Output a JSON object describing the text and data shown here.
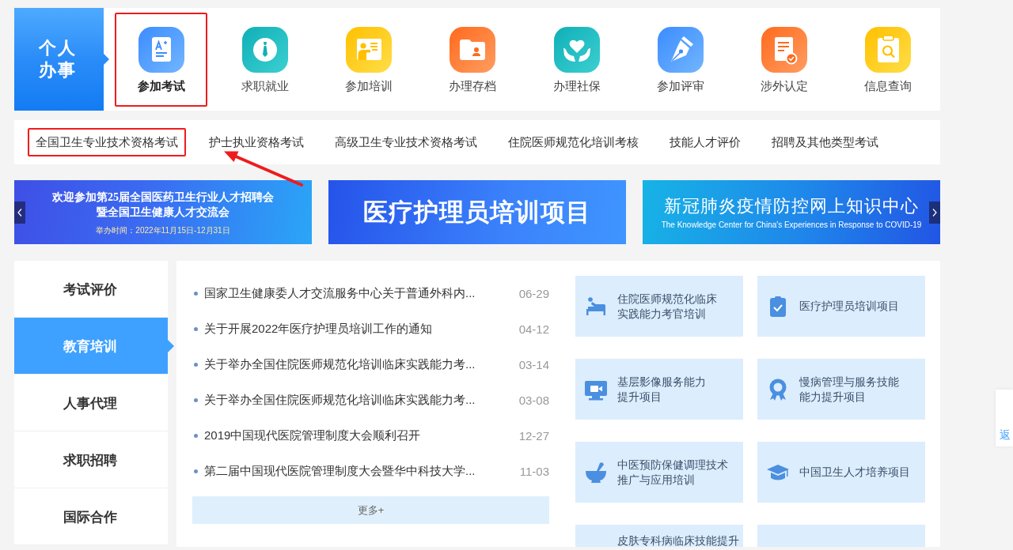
{
  "service_panel": {
    "title": "个人办事",
    "items": [
      {
        "label": "参加考试",
        "selected": true,
        "highlighted": true
      },
      {
        "label": "求职就业",
        "selected": false,
        "highlighted": false
      },
      {
        "label": "参加培训",
        "selected": false,
        "highlighted": false
      },
      {
        "label": "办理存档",
        "selected": false,
        "highlighted": false
      },
      {
        "label": "办理社保",
        "selected": false,
        "highlighted": false
      },
      {
        "label": "参加评审",
        "selected": false,
        "highlighted": false
      },
      {
        "label": "涉外认定",
        "selected": false,
        "highlighted": false
      },
      {
        "label": "信息查询",
        "selected": false,
        "highlighted": false
      }
    ]
  },
  "exam_categories": [
    {
      "label": "全国卫生专业技术资格考试",
      "highlighted": true
    },
    {
      "label": "护士执业资格考试",
      "highlighted": false
    },
    {
      "label": "高级卫生专业技术资格考试",
      "highlighted": false
    },
    {
      "label": "住院医师规范化培训考核",
      "highlighted": false
    },
    {
      "label": "技能人才评价",
      "highlighted": false
    },
    {
      "label": "招聘及其他类型考试",
      "highlighted": false
    }
  ],
  "banners": [
    {
      "kind": "event",
      "title": "欢迎参加第25届全国医药卫生行业人才招聘会",
      "subtitle": "暨全国卫生健康人才交流会",
      "note": "举办时间：2022年11月15日-12月31日"
    },
    {
      "kind": "headline",
      "title": "医疗护理员培训项目"
    },
    {
      "kind": "bilingual",
      "title": "新冠肺炎疫情防控网上知识中心",
      "subtitle": "The Knowledge Center for China's Experiences in Response to COVID-19"
    }
  ],
  "sidebar": {
    "tabs": [
      {
        "label": "考试评价",
        "selected": false
      },
      {
        "label": "教育培训",
        "selected": true
      },
      {
        "label": "人事代理",
        "selected": false
      },
      {
        "label": "求职招聘",
        "selected": false
      },
      {
        "label": "国际合作",
        "selected": false
      }
    ]
  },
  "news": {
    "items": [
      {
        "title": "国家卫生健康委人才交流服务中心关于普通外科内...",
        "date": "06-29"
      },
      {
        "title": "关于开展2022年医疗护理员培训工作的通知",
        "date": "04-12"
      },
      {
        "title": "关于举办全国住院医师规范化培训临床实践能力考...",
        "date": "03-14"
      },
      {
        "title": "关于举办全国住院医师规范化培训临床实践能力考...",
        "date": "03-08"
      },
      {
        "title": "2019中国现代医院管理制度大会顺利召开",
        "date": "12-27"
      },
      {
        "title": "第二届中国现代医院管理制度大会暨华中科技大学...",
        "date": "11-03"
      }
    ],
    "more_button": "更多+"
  },
  "projects": [
    {
      "title_lines": [
        "住院医师规范化临床",
        "实践能力考官培训"
      ]
    },
    {
      "title_lines": [
        "医疗护理员培训项目"
      ]
    },
    {
      "title_lines": [
        "基层影像服务能力",
        "提升项目"
      ]
    },
    {
      "title_lines": [
        "慢病管理与服务技能",
        "能力提升项目"
      ]
    },
    {
      "title_lines": [
        "中医预防保健调理技术",
        "推广与应用培训"
      ]
    },
    {
      "title_lines": [
        "中国卫生人才培养项目"
      ]
    },
    {
      "title_lines": [
        "皮肤专科病临床技能提升"
      ]
    }
  ],
  "side_tool": {
    "label": "返"
  }
}
